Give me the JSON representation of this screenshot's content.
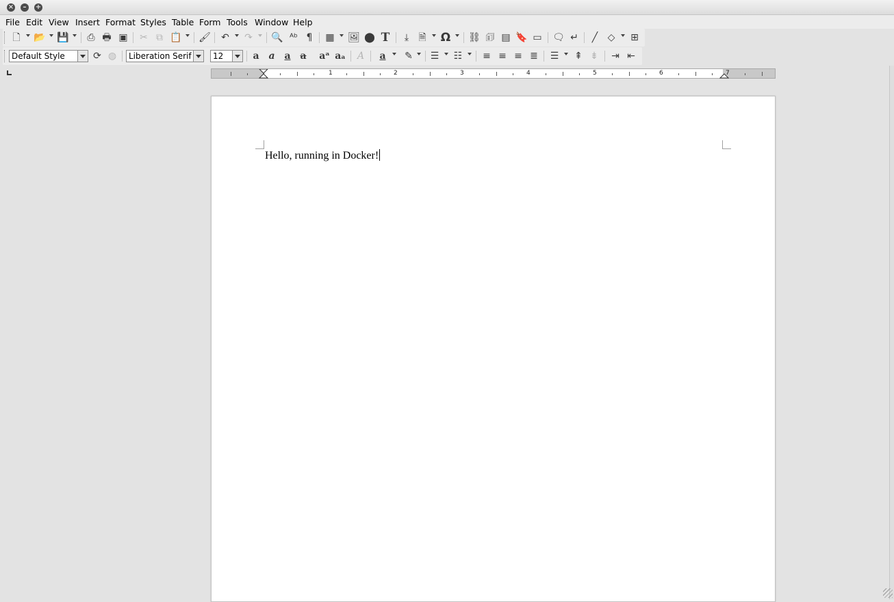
{
  "window": {
    "controls": [
      "close-icon",
      "minimize-icon",
      "maximize-icon"
    ]
  },
  "menu": [
    "File",
    "Edit",
    "View",
    "Insert",
    "Format",
    "Styles",
    "Table",
    "Form",
    "Tools",
    "Window",
    "Help"
  ],
  "formatting": {
    "paragraph_style": "Default Style",
    "font_name": "Liberation Serif",
    "font_size": "12"
  },
  "ruler": {
    "numbers": [
      "1",
      "2",
      "3",
      "4",
      "5",
      "6",
      "7"
    ]
  },
  "document": {
    "text": "Hello, running in Docker!"
  },
  "colors": {
    "background": "#e3e3e3",
    "page": "#ffffff",
    "toolbar": "#ececec"
  }
}
